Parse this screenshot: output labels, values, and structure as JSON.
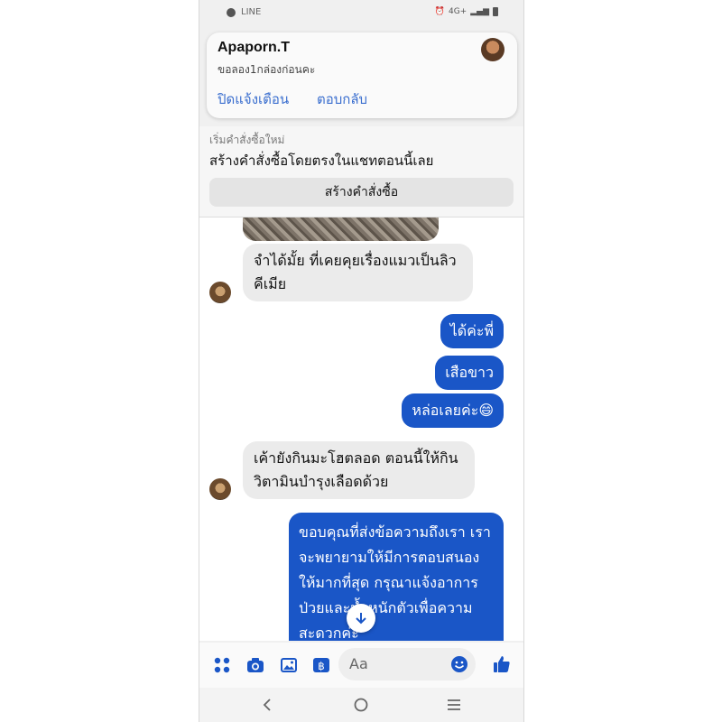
{
  "status_bar": {
    "app_name": "LINE",
    "network": "4G+"
  },
  "notification": {
    "sender": "Apaporn.T",
    "message": "ขอลอง1กล่องก่อนคะ",
    "action_dismiss": "ปิดแจ้งเตือน",
    "action_reply": "ตอบกลับ"
  },
  "order_banner": {
    "subtitle": "เริ่มคำสั่งซื้อใหม่",
    "title": "สร้างคำสั่งซื้อโดยตรงในแชทตอนนี้เลย",
    "button_label": "สร้างคำสั่งซื้อ"
  },
  "messages": [
    {
      "direction": "in",
      "text": "จำได้มั้ย ที่เคยคุยเรื่องแมวเป็นลิวคีเมีย"
    },
    {
      "direction": "out",
      "text": "ได้ค่ะพี่"
    },
    {
      "direction": "out",
      "text": "เสือขาว"
    },
    {
      "direction": "out",
      "text": "หล่อเลยค่ะ😄"
    },
    {
      "direction": "in",
      "text": "เค้ายังกินมะโฮตลอด ตอนนี้ให้กินวิตามินบำรุงเลือดด้วย"
    },
    {
      "direction": "out",
      "text": "ขอบคุณที่ส่งข้อความถึงเรา เราจะพยายามให้มีการตอบสนองให้มากที่สุด กรุณาแจ้งอาการป่วยและน้ำหนักตัวเพื่อความสะดวกค่ะ"
    }
  ],
  "composer": {
    "placeholder": "Aa"
  },
  "colors": {
    "accent": "#1a56c7",
    "link": "#3b6fcf",
    "incoming_bubble": "#ebebeb"
  },
  "icons": [
    "menu-dots-icon",
    "camera-icon",
    "gallery-icon",
    "wallet-icon",
    "emoji-icon",
    "like-icon",
    "arrow-down-icon",
    "back-icon",
    "home-icon",
    "recents-icon"
  ]
}
